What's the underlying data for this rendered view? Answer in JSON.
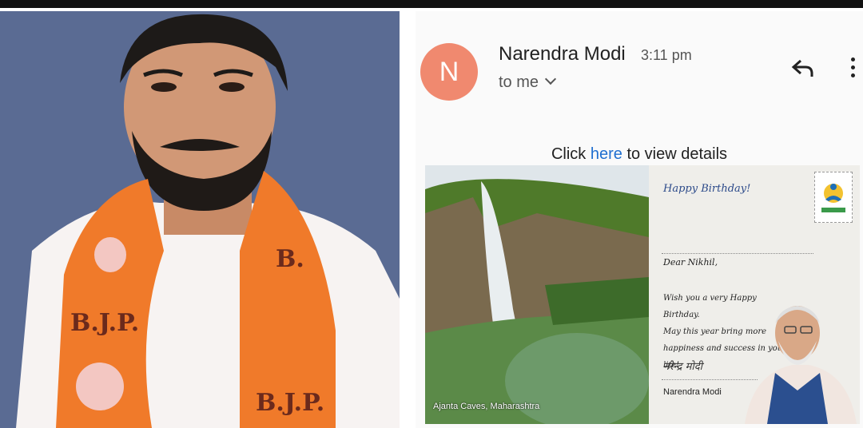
{
  "email": {
    "avatar_letter": "N",
    "sender": "Narendra Modi",
    "time": "3:11 pm",
    "recipient": "to me",
    "click_prefix": "Click",
    "click_link": "here",
    "click_suffix": "to view details"
  },
  "card": {
    "caption": "Ajanta Caves, Maharashtra",
    "greeting": "Happy Birthday!",
    "salutation": "Dear Nikhil,",
    "message_lines": [
      "Wish you a very Happy Birthday.",
      "May this year bring more",
      "happiness and success in your life!"
    ],
    "signature_script": "नरेन्द्र मोदी",
    "signature_name": "Narendra Modi"
  },
  "photo": {
    "scarf_text_top": "B.",
    "scarf_text_left": "B.J.P.",
    "scarf_text_bottom": "B.J.P."
  },
  "colors": {
    "photo_bg": "#5a6b93",
    "scarf": "#f07a2a",
    "avatar": "#f0896f",
    "link": "#1f6fd0"
  }
}
